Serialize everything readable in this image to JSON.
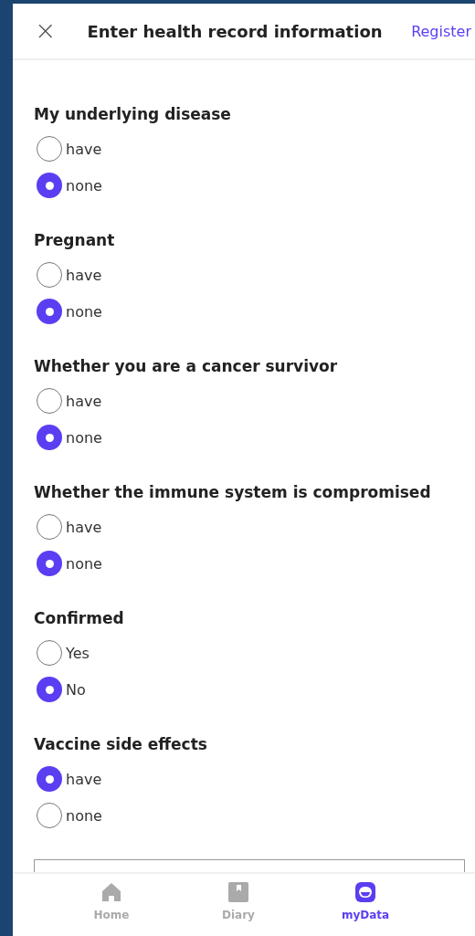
{
  "header": {
    "close": "×",
    "title": "Enter health record information",
    "action": "Register"
  },
  "questions": [
    {
      "title": "My underlying disease",
      "options": [
        {
          "label": "have",
          "selected": false
        },
        {
          "label": "none",
          "selected": true
        }
      ]
    },
    {
      "title": "Pregnant",
      "options": [
        {
          "label": "have",
          "selected": false
        },
        {
          "label": "none",
          "selected": true
        }
      ]
    },
    {
      "title": "Whether you are a cancer survivor",
      "options": [
        {
          "label": "have",
          "selected": false
        },
        {
          "label": "none",
          "selected": true
        }
      ]
    },
    {
      "title": "Whether the immune system is compromised",
      "options": [
        {
          "label": "have",
          "selected": false
        },
        {
          "label": "none",
          "selected": true
        }
      ]
    },
    {
      "title": "Confirmed",
      "options": [
        {
          "label": "Yes",
          "selected": false
        },
        {
          "label": "No",
          "selected": true
        }
      ]
    },
    {
      "title": "Vaccine side effects",
      "options": [
        {
          "label": "have",
          "selected": true
        },
        {
          "label": "none",
          "selected": false
        }
      ]
    }
  ],
  "tabs": [
    {
      "kind": "home",
      "label": "Home",
      "selected": false
    },
    {
      "kind": "diary",
      "label": "Diary",
      "selected": false
    },
    {
      "kind": "mydata",
      "label": "myData",
      "selected": true
    }
  ]
}
